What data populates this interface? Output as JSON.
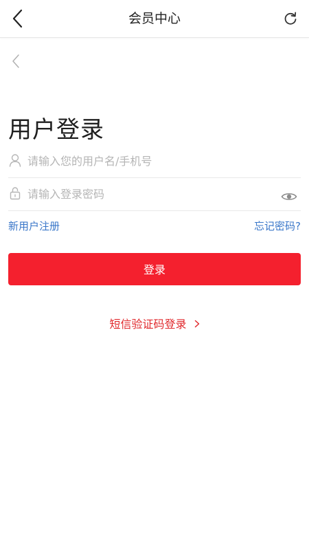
{
  "header": {
    "title": "会员中心"
  },
  "login": {
    "heading": "用户登录",
    "username_placeholder": "请输入您的用户名/手机号",
    "password_placeholder": "请输入登录密码",
    "register_label": "新用户注册",
    "forgot_label": "忘记密码?",
    "submit_label": "登录",
    "sms_login_label": "短信验证码登录"
  },
  "icons": {
    "back": "chevron-left-icon",
    "refresh": "refresh-icon",
    "user": "user-icon",
    "lock": "lock-icon",
    "eye": "eye-icon",
    "chevron": "chevron-right-icon"
  },
  "colors": {
    "accent": "#f4202e",
    "link": "#3a77c9",
    "sms_link": "#e0282c"
  }
}
